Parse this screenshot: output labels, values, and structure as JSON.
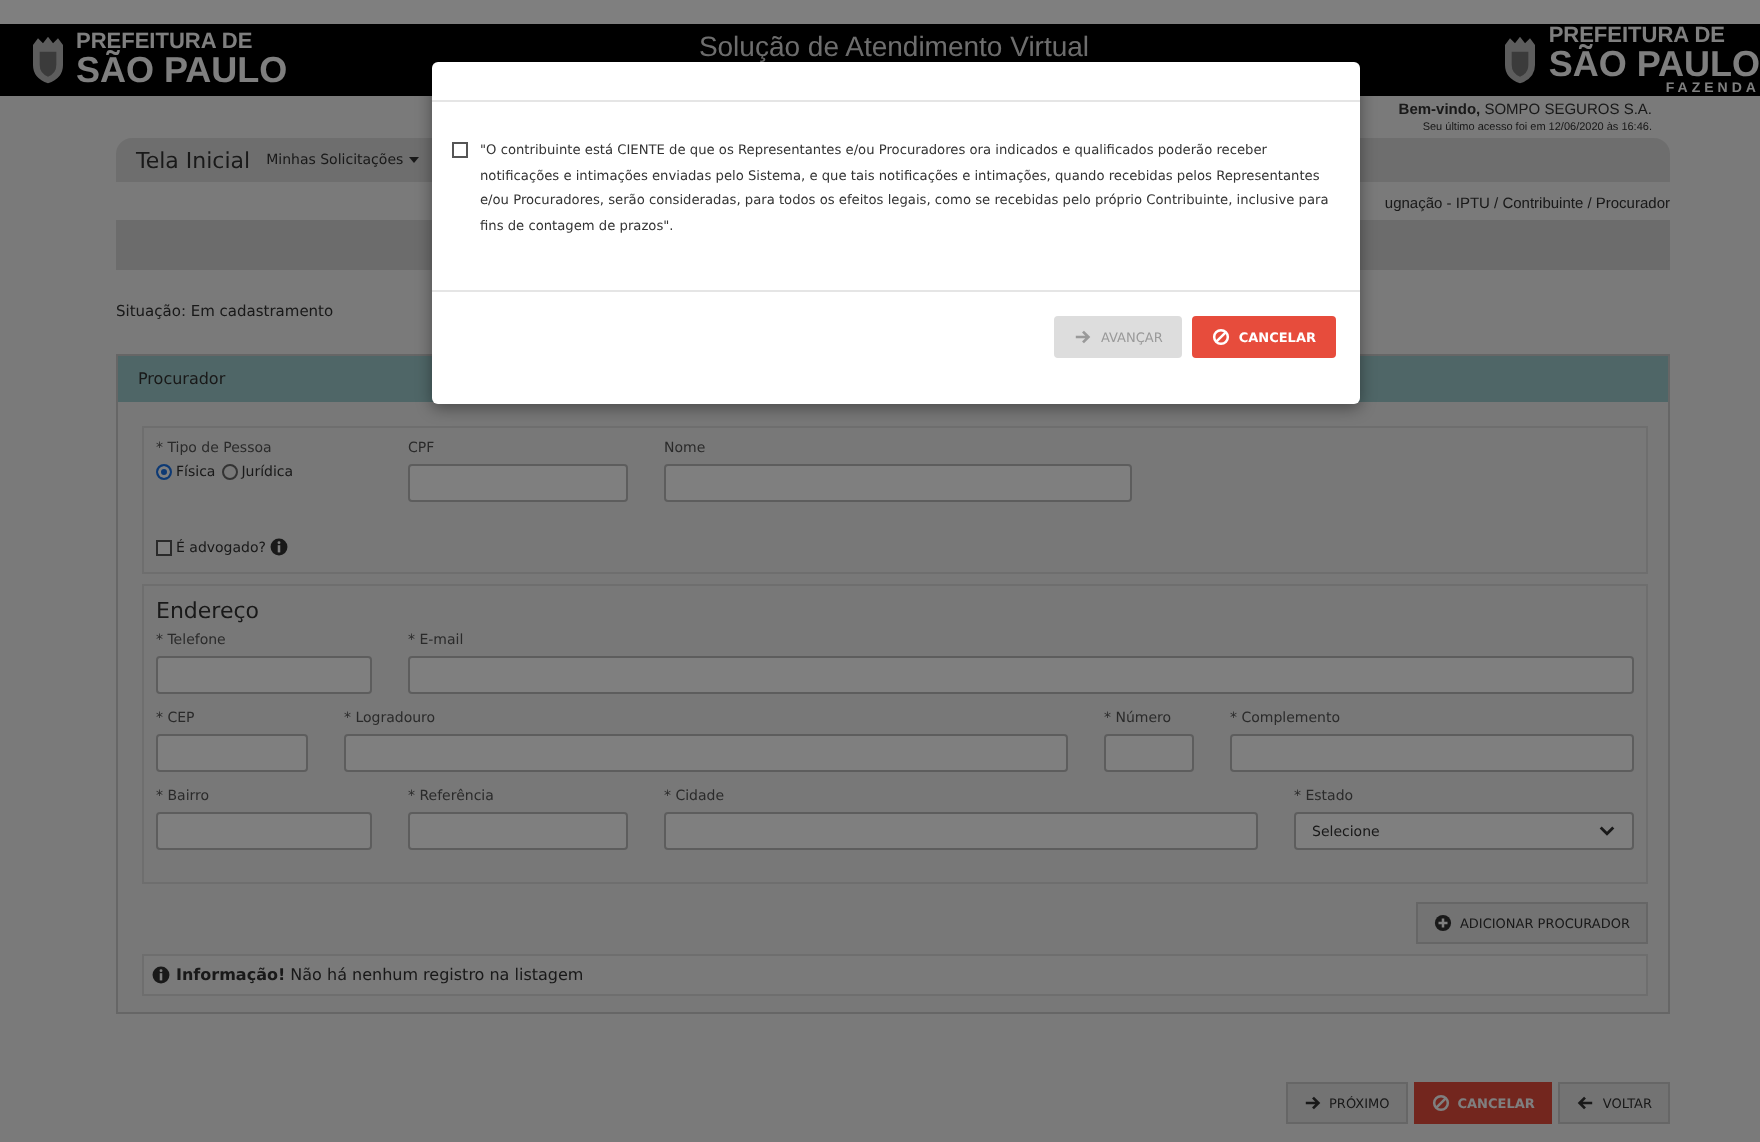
{
  "header": {
    "logo_left": {
      "line1": "PREFEITURA DE",
      "line2": "SÃO PAULO"
    },
    "title": "Solução de Atendimento Virtual",
    "logo_right": {
      "line1": "PREFEITURA DE",
      "line2": "SÃO PAULO",
      "line3": "FAZENDA"
    }
  },
  "welcome": {
    "greeting": "Bem-vindo,",
    "user": "SOMPO SEGUROS S.A.",
    "last_access": "Seu último acesso foi em 12/06/2020 às 16:46."
  },
  "nav": [
    {
      "label": "Tela Inicial",
      "kind": "home"
    },
    {
      "label": "Minhas Solicitações",
      "kind": "dropdown"
    }
  ],
  "breadcrumb": "ugnação - IPTU / Contribuinte / Procurador",
  "status": "Situação: Em cadastramento",
  "panel": {
    "title": "Procurador",
    "person": {
      "label": "* Tipo de Pessoa",
      "radios": [
        {
          "label": "Física",
          "selected": true
        },
        {
          "label": "Jurídica",
          "selected": false
        }
      ],
      "cpf_label": "CPF",
      "name_label": "Nome",
      "lawyer": {
        "label": "É advogado?",
        "checked": false
      }
    },
    "address": {
      "legend": "Endereço",
      "rows": [
        [
          {
            "label": "* Telefone",
            "kind": "input"
          },
          {
            "label": "* E-mail",
            "kind": "input"
          }
        ],
        [
          {
            "label": "* CEP",
            "kind": "input"
          },
          {
            "label": "* Logradouro",
            "kind": "input"
          },
          {
            "label": "* Número",
            "kind": "input"
          },
          {
            "label": "* Complemento",
            "kind": "input"
          }
        ],
        [
          {
            "label": "* Bairro",
            "kind": "input"
          },
          {
            "label": "* Referência",
            "kind": "input"
          },
          {
            "label": "* Cidade",
            "kind": "input"
          },
          {
            "label": "* Estado",
            "kind": "select",
            "value": "Selecione"
          }
        ]
      ]
    },
    "add_button": "ADICIONAR PROCURADOR",
    "info": "**Informação!** Não há nenhum registro na listagem"
  },
  "footer_buttons": [
    {
      "label": "PRÓXIMO",
      "kind": "next"
    },
    {
      "label": "CANCELAR",
      "kind": "cancel"
    },
    {
      "label": "VOLTAR",
      "kind": "back"
    }
  ],
  "modal": {
    "checkbox": {
      "checked": false,
      "text": "\"O contribuinte está CIENTE de que os Representantes e/ou Procuradores ora indicados e qualificados poderão receber notificações e intimações enviadas pelo Sistema, e que tais notificações e intimações, quando recebidas pelos Representantes e/ou Procuradores, serão consideradas, para todos os efeitos legais, como se recebidas pelo próprio Contribuinte, inclusive para fins de contagem de prazos\"."
    },
    "buttons": [
      {
        "label": "AVANÇAR",
        "kind": "next",
        "disabled": true
      },
      {
        "label": "CANCELAR",
        "kind": "cancel",
        "disabled": false
      }
    ]
  }
}
